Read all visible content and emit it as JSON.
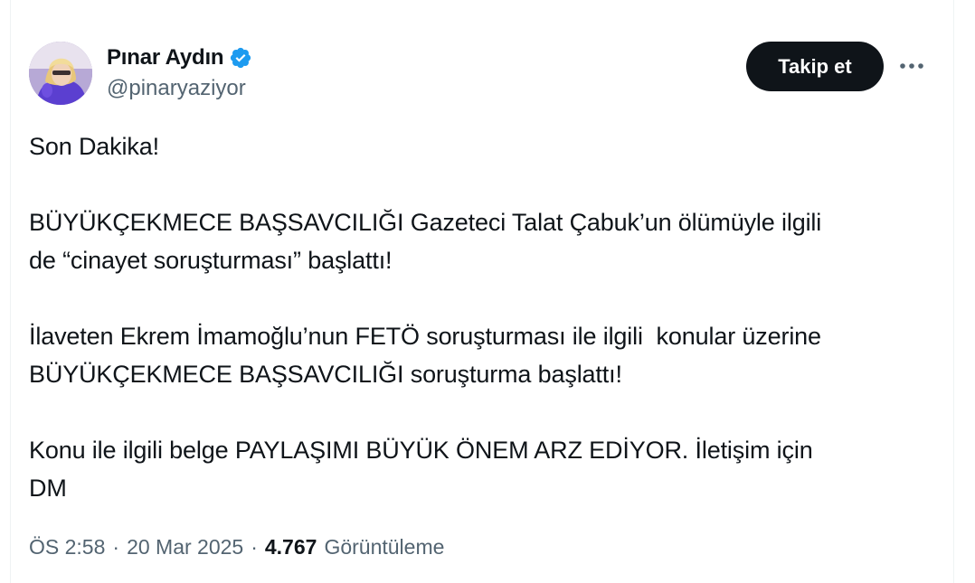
{
  "author": {
    "display_name": "Pınar Aydın",
    "handle": "@pinaryaziyor",
    "verified": true,
    "verified_color": "#1d9bf0"
  },
  "actions": {
    "follow_label": "Takip et",
    "more_icon": "more-horizontal-icon"
  },
  "tweet": {
    "paragraphs": [
      [
        "Son Dakika!"
      ],
      [
        "BÜYÜKÇEKMECE BAŞSAVCILIĞI Gazeteci Talat Çabuk’un ölümüyle ilgili",
        "de “cinayet soruşturması” başlattı!"
      ],
      [
        "İlaveten Ekrem İmamoğlu’nun FETÖ soruşturması ile ilgili  konular üzerine",
        "BÜYÜKÇEKMECE BAŞSAVCILIĞI soruşturma başlattı!"
      ],
      [
        "Konu ile ilgili belge PAYLAŞIMI BÜYÜK ÖNEM ARZ EDİYOR. İletişim için",
        "DM"
      ]
    ]
  },
  "meta": {
    "time": "ÖS 2:58",
    "separator": "·",
    "date": "20 Mar 2025",
    "views_count": "4.767",
    "views_label": "Görüntüleme"
  },
  "colors": {
    "text_primary": "#0f1419",
    "text_secondary": "#536471",
    "button_bg": "#0f1419",
    "border": "#eff3f4"
  }
}
